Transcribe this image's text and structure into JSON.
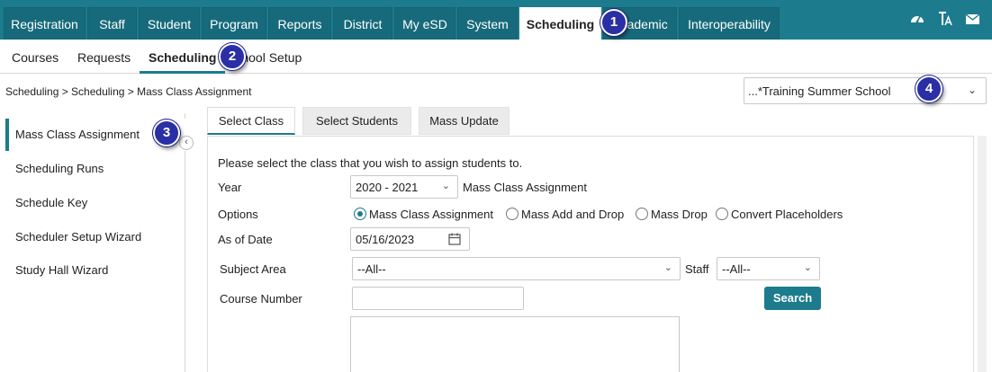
{
  "topnav": {
    "tabs": [
      "Registration",
      "Staff",
      "Student",
      "Program",
      "Reports",
      "District",
      "My eSD",
      "System",
      "Scheduling",
      "Academic",
      "Interoperability"
    ],
    "active": "Scheduling",
    "icons": [
      "dashboard-icon",
      "font-icon",
      "mail-icon"
    ]
  },
  "subnav": {
    "items": [
      "Courses",
      "Requests",
      "Scheduling",
      "School Setup"
    ],
    "active": "Scheduling"
  },
  "breadcrumb": "Scheduling > Scheduling > Mass Class Assignment",
  "school_selector": {
    "value": "...*Training Summer School"
  },
  "sidebar": {
    "items": [
      "Mass Class Assignment",
      "Scheduling Runs",
      "Schedule Key",
      "Scheduler Setup Wizard",
      "Study Hall Wizard"
    ],
    "active": "Mass Class Assignment"
  },
  "tabs": [
    "Select Class",
    "Select Students",
    "Mass Update"
  ],
  "form": {
    "instruction": "Please select the class that you wish to assign students to.",
    "year_label": "Year",
    "year_value": "2020 - 2021",
    "year_suffix": "Mass Class Assignment",
    "options_label": "Options",
    "options": [
      "Mass Class Assignment",
      "Mass Add and Drop",
      "Mass Drop",
      "Convert Placeholders"
    ],
    "options_selected": "Mass Class Assignment",
    "as_of_label": "As of Date",
    "as_of_value": "05/16/2023",
    "subject_label": "Subject Area",
    "subject_value": "--All--",
    "staff_label": "Staff",
    "staff_value": "--All--",
    "course_label": "Course Number",
    "course_value": "",
    "search_label": "Search"
  },
  "callouts": [
    "1",
    "2",
    "3",
    "4"
  ],
  "colors": {
    "primary": "#1d7b8e",
    "callout": "#2a2fa6"
  }
}
